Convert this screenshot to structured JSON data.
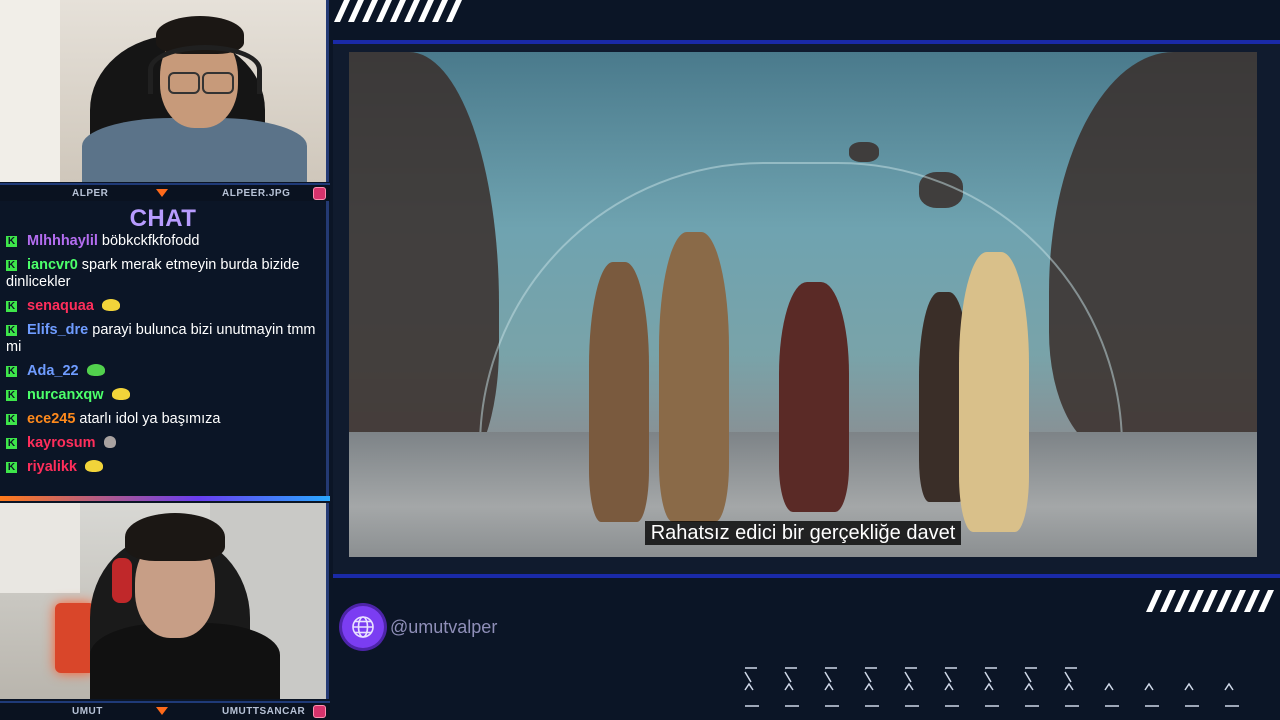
{
  "streamers": {
    "top": {
      "name": "ALPER",
      "handle": "ALPEER.JPG"
    },
    "bottom": {
      "name": "UMUT",
      "handle": "UMUTTSANCAR"
    }
  },
  "chat": {
    "title": "CHAT",
    "messages": [
      {
        "user": "Mlhhhaylil",
        "color": "#b46df0",
        "text": "böbkckfkfofodd",
        "emote": ""
      },
      {
        "user": "iancvr0",
        "color": "#4cff6a",
        "text": "spark merak etmeyin burda bizide dinlicekler",
        "emote": ""
      },
      {
        "user": "senaquaa",
        "color": "#ff2e5b",
        "text": "",
        "emote": "yellow-face-emote"
      },
      {
        "user": "Elifs_dre",
        "color": "#6f9cff",
        "text": "parayi bulunca bizi unutmayin tmm mi",
        "emote": ""
      },
      {
        "user": "Ada_22",
        "color": "#6f9cff",
        "text": "",
        "emote": "green-frog-emote"
      },
      {
        "user": "nurcanxqw",
        "color": "#4cff6a",
        "text": "",
        "emote": "yellow-face-emote"
      },
      {
        "user": "ece245",
        "color": "#ff8a1c",
        "text": "atarlı idol ya başımıza",
        "emote": ""
      },
      {
        "user": "kayrosum",
        "color": "#ff2e5b",
        "text": "",
        "emote": "person-emote"
      },
      {
        "user": "riyalikk",
        "color": "#ff2e5b",
        "text": "",
        "emote": "yellow-face-emote"
      }
    ]
  },
  "video": {
    "subtitle": "Rahatsız edici bir gerçekliğe davet"
  },
  "social": {
    "icon": "globe-icon",
    "handle": "@umutvalper"
  },
  "colors": {
    "background": "#0b1526",
    "frame_border": "#1a2aa8",
    "chat_title": "#b89cff",
    "badge": "#3ee64a",
    "accent_orange": "#ff6a1a",
    "accent_purple": "#7b3df2"
  }
}
